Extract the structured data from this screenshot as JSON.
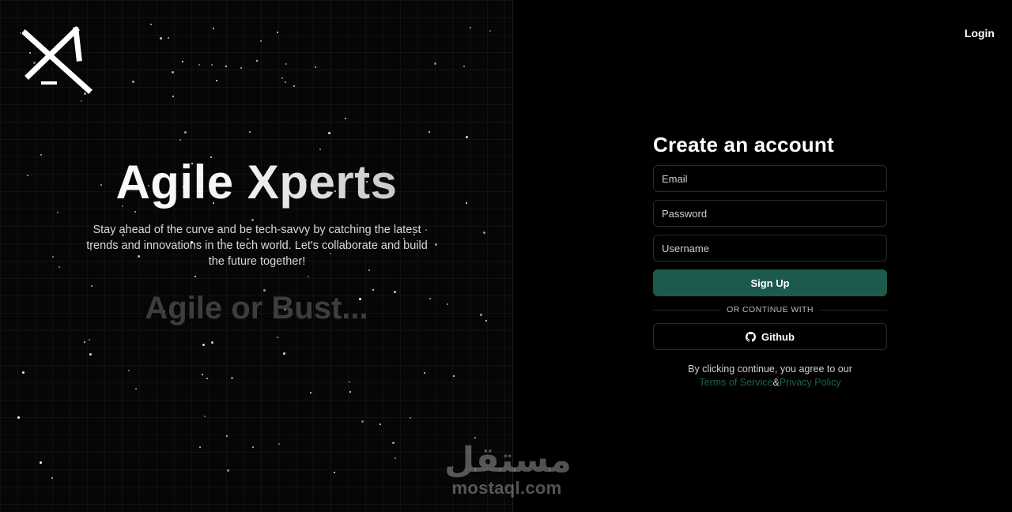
{
  "hero": {
    "title": "Agile Xperts",
    "subtitle": "Stay ahead of the curve and be tech-savvy by catching the latest trends and innovations in the tech world. Let's collaborate and build the future together!",
    "tagline": "Agile or Bust..."
  },
  "header": {
    "login_label": "Login"
  },
  "form": {
    "title": "Create an account",
    "email_placeholder": "Email",
    "password_placeholder": "Password",
    "username_placeholder": "Username",
    "signup_label": "Sign Up",
    "divider_text": "OR CONTINUE WITH",
    "github_label": "Github",
    "github_icon": "github-icon",
    "terms_prefix": "By clicking continue, you agree to our",
    "terms_link": "Terms of Service",
    "terms_joiner": "&",
    "privacy_link": "Privacy Policy"
  },
  "watermark": {
    "arabic": "مستقل",
    "latin": "mostaql.com"
  },
  "colors": {
    "background": "#000000",
    "accent": "#1c5a4e",
    "link": "#1f5e52"
  }
}
